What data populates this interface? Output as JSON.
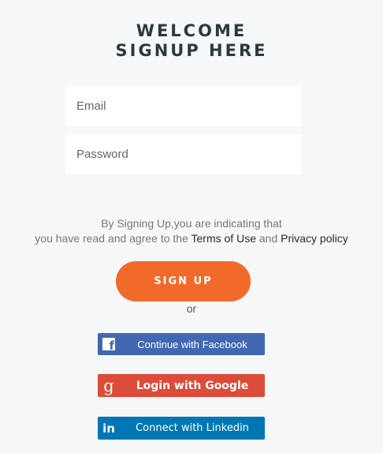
{
  "header": {
    "title_line1": "WELCOME",
    "title_line2": "SIGNUP HERE"
  },
  "form": {
    "email_placeholder": "Email",
    "email_value": "",
    "password_placeholder": "Password",
    "password_value": ""
  },
  "terms": {
    "line1": "By Signing Up,you are indicating that",
    "line2_prefix": "you have read and agree to the ",
    "terms_link": "Terms of Use",
    "conjunction": " and ",
    "privacy_link": "Privacy policy"
  },
  "signup_button": "SIGN UP",
  "separator": "or",
  "social": {
    "facebook": {
      "label": "Continue with Facebook",
      "icon": "facebook-icon",
      "color": "#4267b2"
    },
    "google": {
      "label": "Login with Google",
      "icon": "google-icon",
      "color": "#dd4b39"
    },
    "linkedin": {
      "label": "Connect with Linkedin",
      "icon": "linkedin-icon",
      "color": "#0077b5"
    }
  },
  "colors": {
    "background": "#f6f7f9",
    "accent": "#f26a2a",
    "title": "#2c3a3c"
  }
}
